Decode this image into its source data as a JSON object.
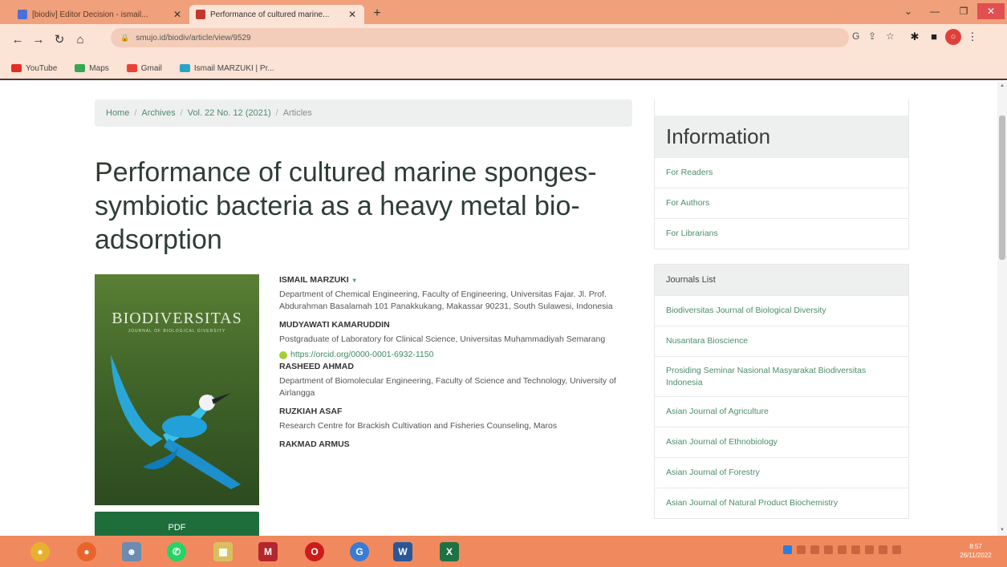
{
  "browser": {
    "tabs": [
      {
        "title": "[biodiv] Editor Decision - ismail...",
        "favicon_color": "#4a6fd6",
        "active": false
      },
      {
        "title": "Performance of cultured marine...",
        "favicon_color": "#c0392b",
        "active": true
      }
    ],
    "new_tab_label": "+",
    "url": "smujo.id/biodiv/article/view/9529",
    "bookmarks": [
      {
        "label": "YouTube",
        "color": "#e52d27"
      },
      {
        "label": "Maps",
        "color": "#34a853"
      },
      {
        "label": "Gmail",
        "color": "#ea4335"
      },
      {
        "label": "Ismail MARZUKI | Pr...",
        "color": "#2aa3c9"
      }
    ]
  },
  "page": {
    "breadcrumb": {
      "home": "Home",
      "archives": "Archives",
      "issue": "Vol. 22 No. 12 (2021)",
      "current": "Articles"
    },
    "title": "Performance of cultured marine sponges-symbiotic bacteria as a heavy metal bio-adsorption",
    "cover": {
      "title": "BIODIVERSITAS",
      "subtitle": "JOURNAL OF BIOLOGICAL DIVERSITY"
    },
    "pdf_label": "PDF",
    "authors": [
      {
        "name": "ISMAIL MARZUKI",
        "toggle": "▾",
        "affiliation": "Department of Chemical Engineering, Faculty of Engineering, Universitas Fajar. Jl. Prof. Abdurahman Basalamah 101 Panakkukang, Makassar 90231, South Sulawesi, Indonesia"
      },
      {
        "name": "MUDYAWATI KAMARUDDIN",
        "affiliation": "Postgraduate of Laboratory for Clinical Science, Universitas Muhammadiyah Semarang",
        "orcid": "https://orcid.org/0000-0001-6932-1150"
      },
      {
        "name": "RASHEED AHMAD",
        "affiliation": "Department of Biomolecular Engineering, Faculty of Science and Technology, University of Airlangga"
      },
      {
        "name": "RUZKIAH ASAF",
        "affiliation": "Research Centre for Brackish Cultivation and Fisheries Counseling, Maros"
      },
      {
        "name": "RAKMAD ARMUS",
        "affiliation": ""
      }
    ]
  },
  "sidebar": {
    "information": {
      "heading": "Information",
      "links": [
        "For Readers",
        "For Authors",
        "For Librarians"
      ]
    },
    "journals": {
      "heading": "Journals List",
      "links": [
        "Biodiversitas Journal of Biological Diversity",
        "Nusantara Bioscience",
        "Prosiding Seminar Nasional Masyarakat Biodiversitas Indonesia",
        "Asian Journal of Agriculture",
        "Asian Journal of Ethnobiology",
        "Asian Journal of Forestry",
        "Asian Journal of Natural Product Biochemistry"
      ]
    }
  },
  "taskbar": {
    "apps": [
      {
        "name": "chrome",
        "color": "#e8b030"
      },
      {
        "name": "firefox",
        "color": "#e8642c"
      },
      {
        "name": "people",
        "color": "#6c8bb0"
      },
      {
        "name": "whatsapp",
        "color": "#25d366"
      },
      {
        "name": "photos",
        "color": "#d8c060"
      },
      {
        "name": "mendeley",
        "color": "#b3262e"
      },
      {
        "name": "opera",
        "color": "#cc1b1b"
      },
      {
        "name": "chrome-2",
        "color": "#3a7bd5"
      },
      {
        "name": "word",
        "color": "#2b5797"
      },
      {
        "name": "excel",
        "color": "#1e7145"
      }
    ],
    "clock_time": "8:57",
    "clock_date": "26/11/2022"
  }
}
